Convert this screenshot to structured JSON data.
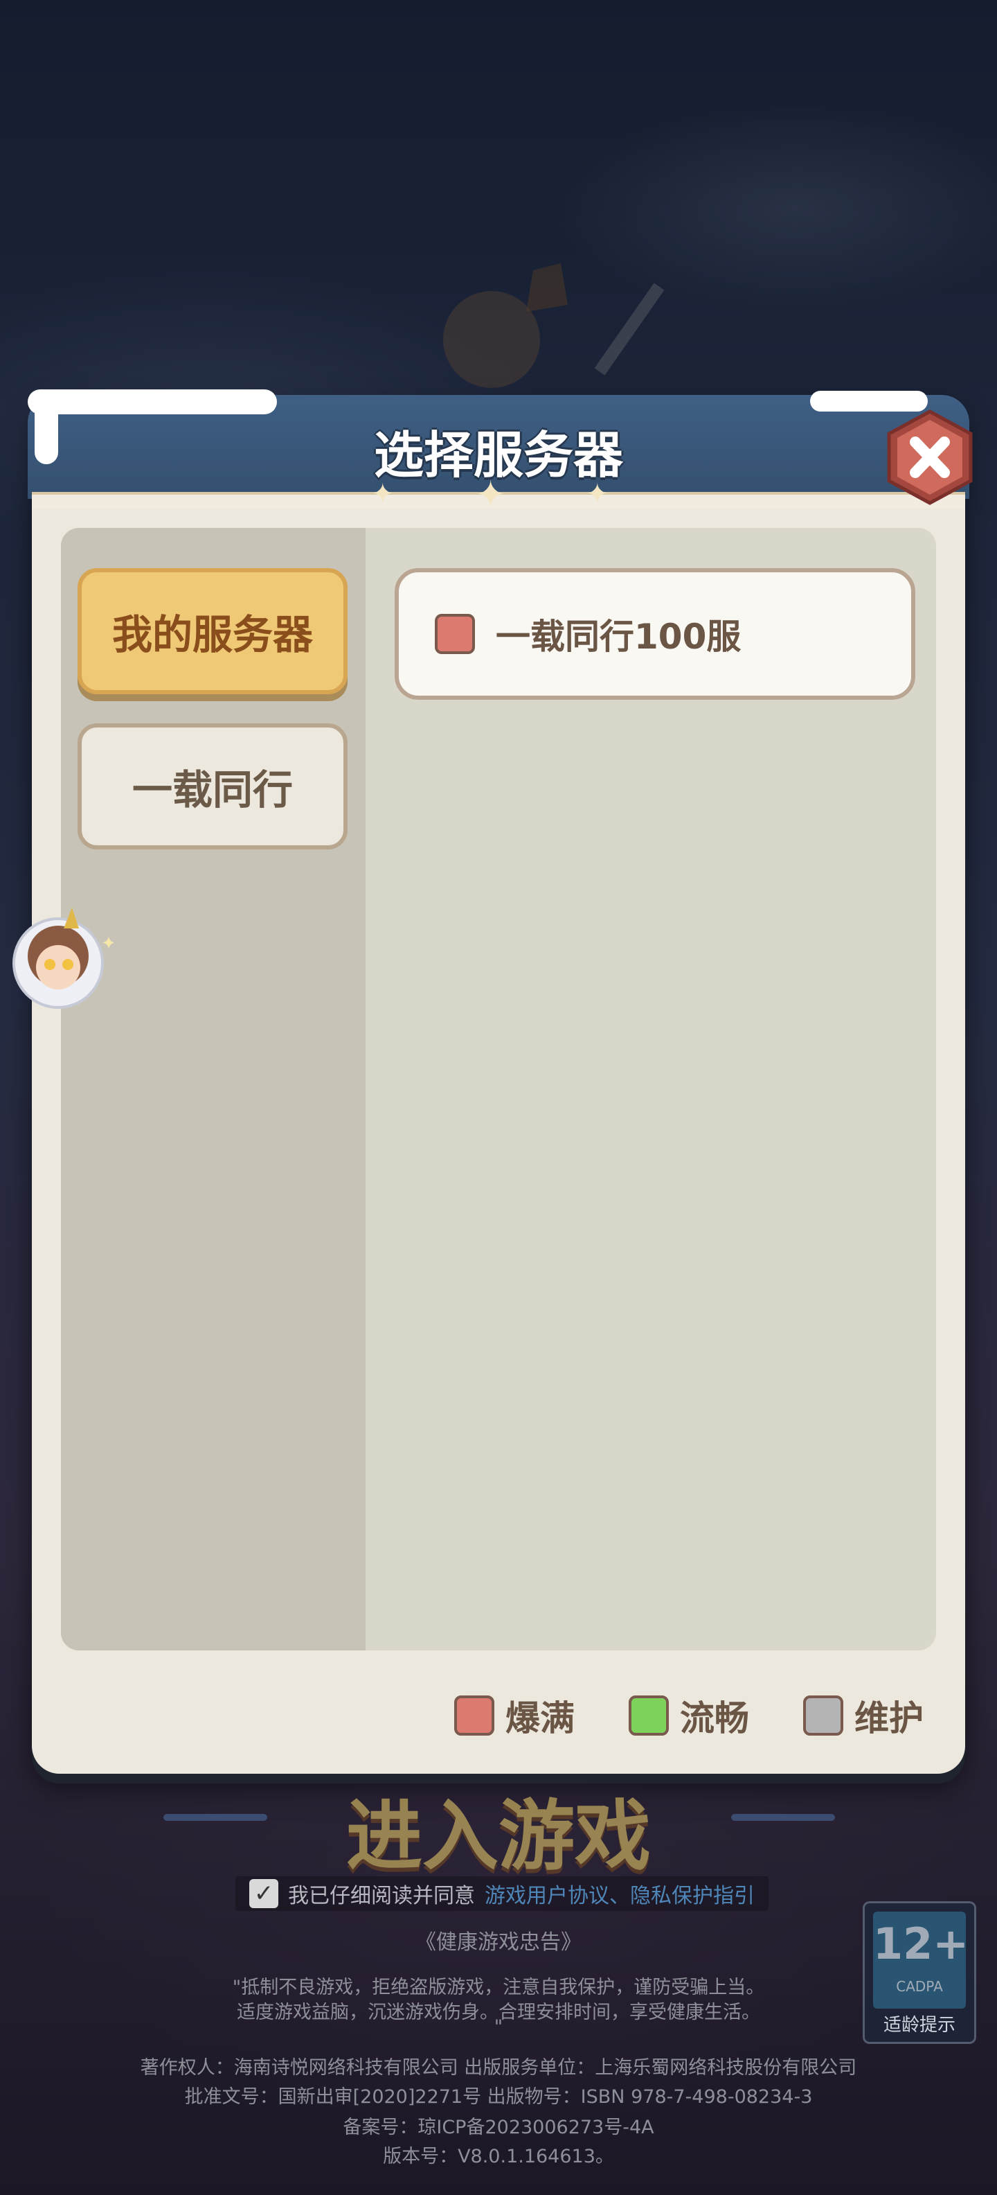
{
  "dialog": {
    "title": "选择服务器",
    "tabs": [
      {
        "label": "我的服务器",
        "active": true
      },
      {
        "label": "一载同行",
        "active": false
      }
    ],
    "servers": [
      {
        "name": "一载同行100服",
        "status": "爆满"
      }
    ],
    "legend": [
      {
        "label": "爆满",
        "color": "#dd7a70"
      },
      {
        "label": "流畅",
        "color": "#7dd35a"
      },
      {
        "label": "维护",
        "color": "#b4b4b4"
      }
    ],
    "close_icon": "close-icon"
  },
  "background": {
    "enter_label": "进入游戏",
    "agreement_prefix": "我已仔细阅读并同意",
    "agreement_links": "游戏用户协议、隐私保护指引",
    "health_title": "《健康游戏忠告》",
    "health_line1": "\"抵制不良游戏，拒绝盗版游戏，注意自我保护，谨防受骗上当。",
    "health_line2": "适度游戏益脑，沉迷游戏伤身。合理安排时间，享受健康生活。",
    "health_line3": "\"",
    "copyright": "著作权人：海南诗悦网络科技有限公司 出版服务单位：上海乐蜀网络科技股份有限公司",
    "approval": "批准文号：国新出审[2020]2271号 出版物号：ISBN 978-7-498-08234-3",
    "icp": "备案号：琼ICP备2023006273号-4A",
    "version": "版本号：V8.0.1.164613。",
    "age_rating": "12+",
    "age_org": "CADPA",
    "age_label": "适龄提示"
  }
}
